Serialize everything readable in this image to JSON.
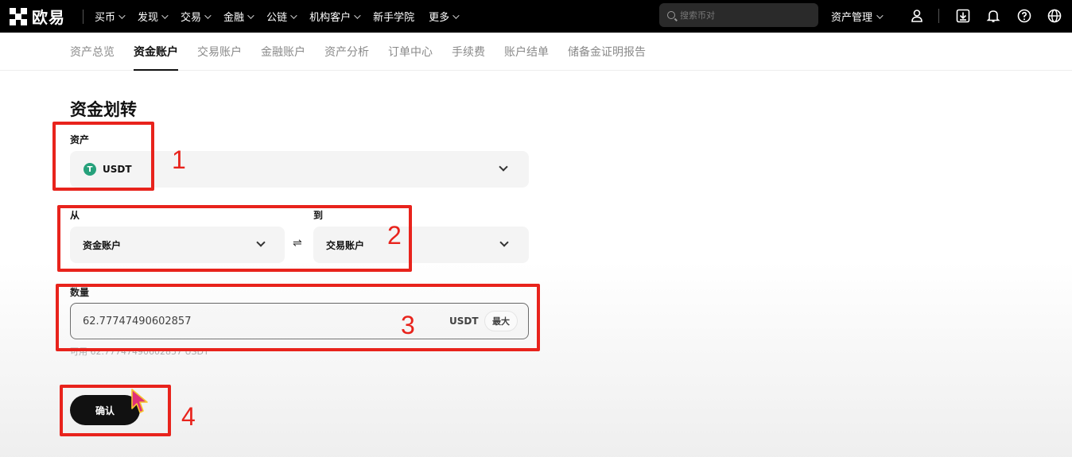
{
  "nav": {
    "brand": "欧易",
    "items": [
      {
        "label": "买币",
        "has_dropdown": true
      },
      {
        "label": "发现",
        "has_dropdown": true
      },
      {
        "label": "交易",
        "has_dropdown": true
      },
      {
        "label": "金融",
        "has_dropdown": true
      },
      {
        "label": "公链",
        "has_dropdown": true
      },
      {
        "label": "机构客户",
        "has_dropdown": true
      },
      {
        "label": "新手学院",
        "has_dropdown": false
      },
      {
        "label": "更多",
        "has_dropdown": true
      }
    ],
    "search_placeholder": "搜索币对",
    "asset_management": "资产管理",
    "icons": [
      "user-icon",
      "download-icon",
      "bell-icon",
      "help-icon",
      "globe-icon"
    ]
  },
  "subtabs": [
    {
      "label": "资产总览",
      "active": false
    },
    {
      "label": "资金账户",
      "active": true
    },
    {
      "label": "交易账户",
      "active": false
    },
    {
      "label": "金融账户",
      "active": false
    },
    {
      "label": "资产分析",
      "active": false
    },
    {
      "label": "订单中心",
      "active": false
    },
    {
      "label": "手续费",
      "active": false
    },
    {
      "label": "账户结单",
      "active": false
    },
    {
      "label": "储备金证明报告",
      "active": false
    }
  ],
  "transfer": {
    "title": "资金划转",
    "asset_label": "资产",
    "asset_value": "USDT",
    "asset_icon_letter": "T",
    "from_label": "从",
    "from_value": "资金账户",
    "to_label": "到",
    "to_value": "交易账户",
    "swap_symbol": "⇌",
    "amount_label": "数量",
    "amount_value": "62.77747490602857",
    "amount_unit": "USDT",
    "max_label": "最大",
    "available_text": "可用 62.77747490602857 USDT",
    "confirm_label": "确认"
  },
  "annotations": [
    "1",
    "2",
    "3",
    "4"
  ],
  "colors": {
    "annotation_red": "#e8231c",
    "usdt_green": "#26a17b",
    "nav_bg": "#000000"
  }
}
